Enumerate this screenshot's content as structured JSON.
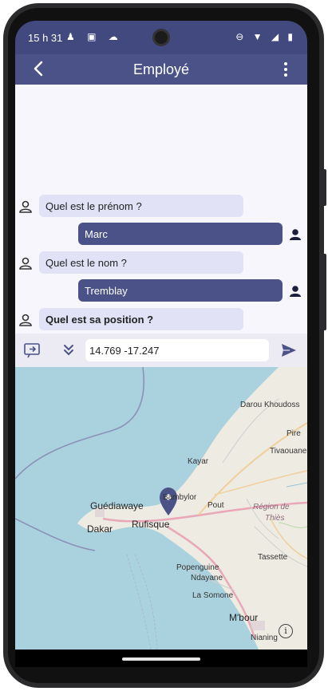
{
  "status": {
    "time": "15 h 31"
  },
  "appbar": {
    "title": "Employé"
  },
  "messages": [
    {
      "side": "in",
      "text": "Quel est le prénom ?",
      "bold": false
    },
    {
      "side": "out",
      "text": "Marc"
    },
    {
      "side": "in",
      "text": "Quel est le nom ?",
      "bold": false
    },
    {
      "side": "out",
      "text": "Tremblay"
    },
    {
      "side": "in",
      "text": "Quel est sa position ?",
      "bold": true
    }
  ],
  "input": {
    "value": "14.769 -17.247"
  },
  "map": {
    "labels": {
      "darou": "Darou Khoudoss",
      "pire": "Pire",
      "tivaouane": "Tivaouane",
      "kayar": "Kayar",
      "bambylor": "Bambylor",
      "guediawaye": "Guédiawaye",
      "pout": "Pout",
      "region": "Région de",
      "thies": "Thiès",
      "dakar": "Dakar",
      "rufisque": "Rufisque",
      "tassette": "Tassette",
      "popenguine": "Popenguine",
      "ndayane": "Ndayane",
      "lasomone": "La Somone",
      "mbour": "M'bour",
      "nianing": "Nianing"
    }
  },
  "colors": {
    "appbar": "#4a5288",
    "bubble_in": "#e1e2f6",
    "bubble_out": "#4a5288",
    "marker": "#4a5288"
  }
}
